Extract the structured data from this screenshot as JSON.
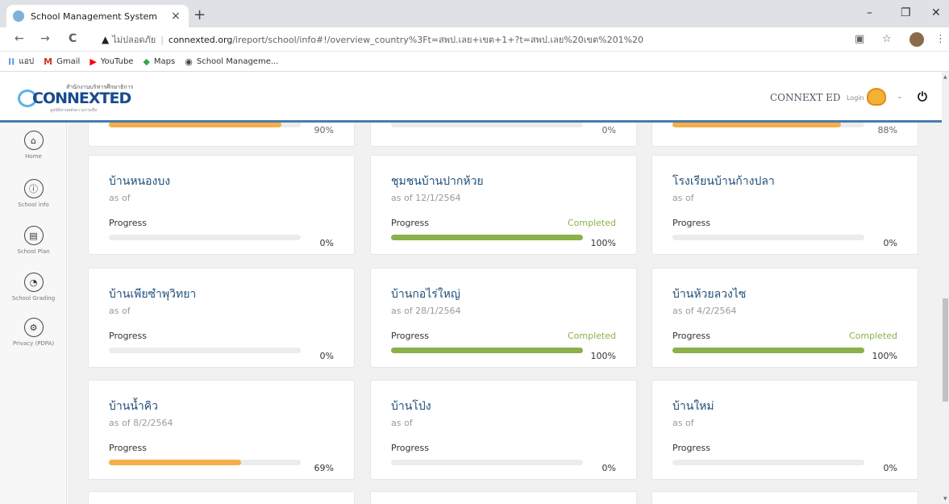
{
  "browser": {
    "tab_title": "School Management System",
    "tab_close": "×",
    "new_tab": "+",
    "win_min": "–",
    "win_max": "❐",
    "win_close": "✕",
    "back": "←",
    "forward": "→",
    "reload": "C",
    "not_secure": "ไม่ปลอดภัย",
    "url_domain": "connexted.org",
    "url_path": "/ireport/school/info#!/overview_country%3Ft=สพป.เลย+เขต+1+?t=สพป.เลย%20เขต%201%20",
    "bookmarks": [
      {
        "label": "แอป",
        "icon": "apps-grid-icon",
        "color": "#1a73e8"
      },
      {
        "label": "Gmail",
        "icon": "gmail-icon",
        "color": "#d93025"
      },
      {
        "label": "YouTube",
        "icon": "youtube-icon",
        "color": "#ff0000"
      },
      {
        "label": "Maps",
        "icon": "maps-icon",
        "color": "#34a853"
      },
      {
        "label": "School Manageme...",
        "icon": "school-favicon",
        "color": "#444444"
      }
    ]
  },
  "header": {
    "logo_top": "สำนักงานบริหารศึกษาธิการ",
    "logo_word": "CONNEXTED",
    "logo_bottom": "มูลนิธิสานพลังความร่วมมือ",
    "brand": "CONNEXT ED",
    "login": "Login",
    "chevron": "⌄",
    "power": "⏻"
  },
  "sidebar": {
    "items": [
      {
        "label": "Home",
        "icon": "home-icon",
        "glyph": "⌂"
      },
      {
        "label": "School info",
        "icon": "school-info-icon",
        "glyph": "ⓘ"
      },
      {
        "label": "School Plan",
        "icon": "school-plan-icon",
        "glyph": "▤"
      },
      {
        "label": "School Grading",
        "icon": "school-grading-icon",
        "glyph": "◔"
      },
      {
        "label": "Privacy (PDPA)",
        "icon": "privacy-gear-icon",
        "glyph": "⚙"
      }
    ]
  },
  "top_partial": [
    {
      "pct": "90%",
      "progress": 0.9,
      "color": "#f6ae48"
    },
    {
      "pct": "0%",
      "progress": 0,
      "color": "#f6ae48"
    },
    {
      "pct": "88%",
      "progress": 0.88,
      "color": "#f6ae48"
    }
  ],
  "cards": [
    {
      "name": "บ้านหนองบง",
      "as_of": "as of",
      "progress_label": "Progress",
      "status": "",
      "pct": "0%",
      "progress": 0,
      "color": "#f6ae48"
    },
    {
      "name": "ชุมชนบ้านปากห้วย",
      "as_of": "as of 12/1/2564",
      "progress_label": "Progress",
      "status": "Completed",
      "pct": "100%",
      "progress": 1,
      "color": "#8ab14a"
    },
    {
      "name": "โรงเรียนบ้านก้างปลา",
      "as_of": "as of",
      "progress_label": "Progress",
      "status": "",
      "pct": "0%",
      "progress": 0,
      "color": "#f6ae48"
    },
    {
      "name": "บ้านเพียซำพุวิทยา",
      "as_of": "as of",
      "progress_label": "Progress",
      "status": "",
      "pct": "0%",
      "progress": 0,
      "color": "#f6ae48"
    },
    {
      "name": "บ้านกอไร่ใหญ่",
      "as_of": "as of 28/1/2564",
      "progress_label": "Progress",
      "status": "Completed",
      "pct": "100%",
      "progress": 1,
      "color": "#8ab14a"
    },
    {
      "name": "บ้านห้วยลวงไซ",
      "as_of": "as of 4/2/2564",
      "progress_label": "Progress",
      "status": "Completed",
      "pct": "100%",
      "progress": 1,
      "color": "#8ab14a"
    },
    {
      "name": "บ้านน้ำคิว",
      "as_of": "as of 8/2/2564",
      "progress_label": "Progress",
      "status": "",
      "pct": "69%",
      "progress": 0.69,
      "color": "#f6ae48"
    },
    {
      "name": "บ้านโป่ง",
      "as_of": "as of",
      "progress_label": "Progress",
      "status": "",
      "pct": "0%",
      "progress": 0,
      "color": "#f6ae48"
    },
    {
      "name": "บ้านใหม่",
      "as_of": "as of",
      "progress_label": "Progress",
      "status": "",
      "pct": "0%",
      "progress": 0,
      "color": "#f6ae48"
    }
  ]
}
